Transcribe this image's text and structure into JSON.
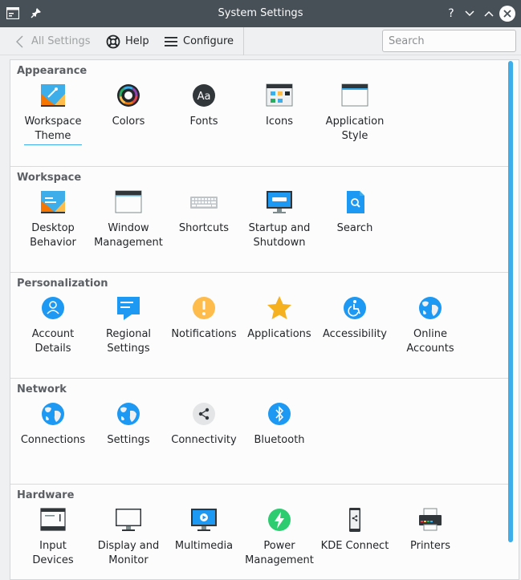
{
  "window": {
    "title": "System Settings",
    "controls": {
      "help": "?",
      "minimize": "∨",
      "maximize": "∧",
      "close": "✕"
    }
  },
  "toolbar": {
    "back_label": "All Settings",
    "help_label": "Help",
    "configure_label": "Configure",
    "search_placeholder": "Search"
  },
  "colors": {
    "titlebar": "#475057",
    "accent": "#3daee9",
    "window_bg": "#eff0f1",
    "content_bg": "#fcfcfc"
  },
  "sections": [
    {
      "title": "Appearance",
      "items": [
        {
          "label": "Workspace\nTheme",
          "icon": "workspace-theme-icon",
          "current": true
        },
        {
          "label": "Colors",
          "icon": "colors-icon"
        },
        {
          "label": "Fonts",
          "icon": "fonts-icon"
        },
        {
          "label": "Icons",
          "icon": "icons-icon"
        },
        {
          "label": "Application\nStyle",
          "icon": "application-style-icon"
        }
      ]
    },
    {
      "title": "Workspace",
      "items": [
        {
          "label": "Desktop\nBehavior",
          "icon": "desktop-behavior-icon"
        },
        {
          "label": "Window\nManagement",
          "icon": "window-management-icon"
        },
        {
          "label": "Shortcuts",
          "icon": "keyboard-icon"
        },
        {
          "label": "Startup and\nShutdown",
          "icon": "startup-shutdown-icon"
        },
        {
          "label": "Search",
          "icon": "search-icon"
        }
      ]
    },
    {
      "title": "Personalization",
      "items": [
        {
          "label": "Account\nDetails",
          "icon": "account-details-icon"
        },
        {
          "label": "Regional\nSettings",
          "icon": "regional-settings-icon"
        },
        {
          "label": "Notifications",
          "icon": "notifications-icon"
        },
        {
          "label": "Applications",
          "icon": "applications-star-icon"
        },
        {
          "label": "Accessibility",
          "icon": "accessibility-icon"
        },
        {
          "label": "Online\nAccounts",
          "icon": "online-accounts-globe-icon"
        }
      ]
    },
    {
      "title": "Network",
      "items": [
        {
          "label": "Connections",
          "icon": "connections-globe-icon"
        },
        {
          "label": "Settings",
          "icon": "network-settings-globe-icon"
        },
        {
          "label": "Connectivity",
          "icon": "connectivity-share-icon"
        },
        {
          "label": "Bluetooth",
          "icon": "bluetooth-icon"
        }
      ]
    },
    {
      "title": "Hardware",
      "items": [
        {
          "label": "Input\nDevices",
          "icon": "input-devices-icon"
        },
        {
          "label": "Display and\nMonitor",
          "icon": "display-monitor-icon"
        },
        {
          "label": "Multimedia",
          "icon": "multimedia-icon"
        },
        {
          "label": "Power\nManagement",
          "icon": "power-management-icon"
        },
        {
          "label": "KDE Connect",
          "icon": "kde-connect-phone-icon"
        },
        {
          "label": "Printers",
          "icon": "printer-icon"
        }
      ]
    }
  ]
}
